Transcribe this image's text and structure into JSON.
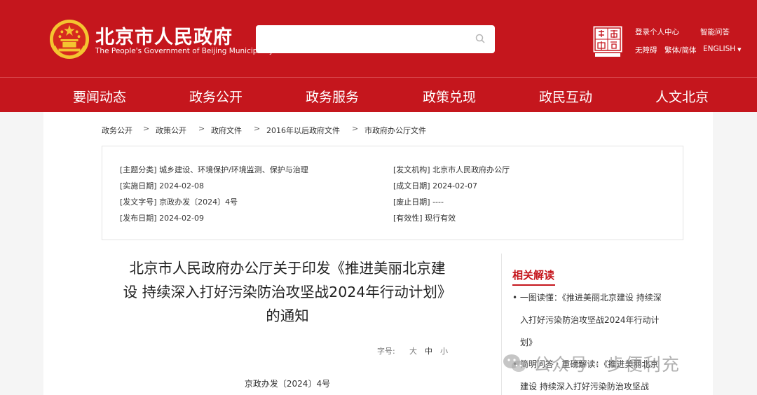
{
  "header": {
    "logo_cn": "北京市人民政府",
    "logo_en": "The People's Government of Beijing Municipality",
    "search": {
      "placeholder": ""
    },
    "links": {
      "login": "登录个人中心",
      "qa": "智能问答",
      "accessible": "无障碍",
      "traditional": "繁体/简体",
      "english": "ENGLISH"
    }
  },
  "nav": [
    "要闻动态",
    "政务公开",
    "政务服务",
    "政策兑现",
    "政民互动",
    "人文北京"
  ],
  "breadcrumb": [
    "政务公开",
    "政策公开",
    "政府文件",
    "2016年以后政府文件",
    "市政府办公厅文件"
  ],
  "info": {
    "subject": "[主题分类] 城乡建设、环境保护/环境监测、保护与治理",
    "issuer": "[发文机构] 北京市人民政府办公厅",
    "effective": "[实施日期] 2024-02-08",
    "created": "[成文日期] 2024-02-07",
    "docnum": "[发文字号] 京政办发〔2024〕4号",
    "repealed": "[废止日期] ----",
    "published": "[发布日期] 2024-02-09",
    "validity": "[有效性] 现行有效"
  },
  "article": {
    "title_lines": [
      "北京市人民政府办公厅关于印发《推进美丽北京建",
      "设 持续深入打好污染防治攻坚战2024年行动计划》",
      "的通知"
    ],
    "font_label": "字号:",
    "font_sizes": [
      "大",
      "中",
      "小"
    ],
    "doc_number": "京政办发〔2024〕4号"
  },
  "related": {
    "title": "相关解读",
    "lines": [
      "• 一图读懂：《推进美丽北京建设 持续深",
      "入打好污染防治攻坚战2024年行动计",
      "划》",
      "• 简明问答 · 重磅解读：《推进美丽北京",
      "建设 持续深入打好污染防治攻坚战"
    ]
  },
  "watermark": "公众号 · 步便利充",
  "colors": {
    "brand_red": "#c5161d",
    "gold": "#f1c40f"
  }
}
